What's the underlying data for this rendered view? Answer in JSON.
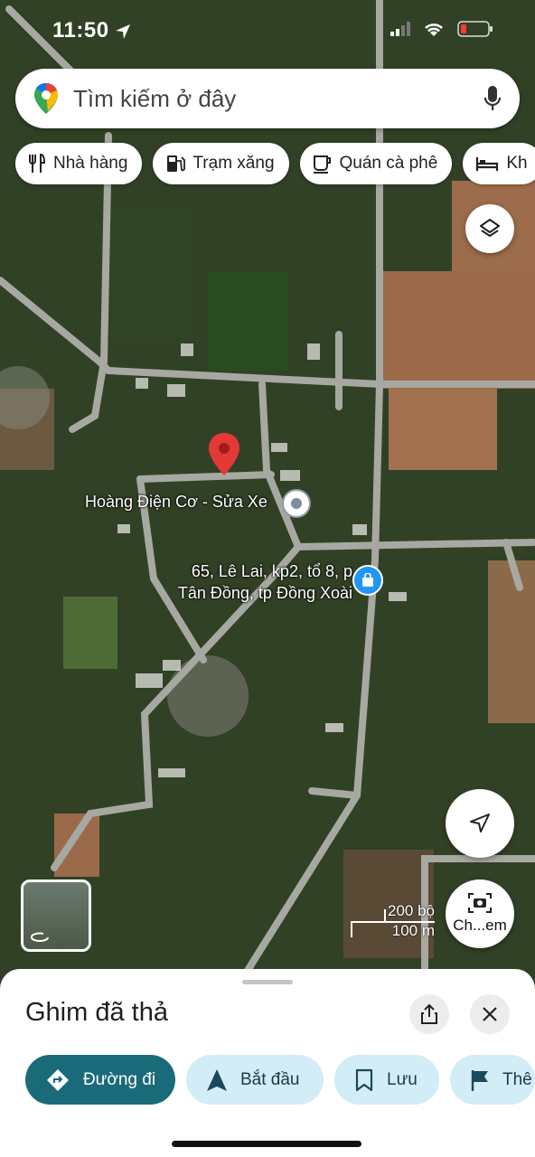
{
  "status_bar": {
    "time": "11:50"
  },
  "search": {
    "placeholder": "Tìm kiếm ở đây"
  },
  "chips": [
    {
      "label": "Nhà hàng",
      "icon": "fork-knife-icon"
    },
    {
      "label": "Trạm xăng",
      "icon": "gas-station-icon"
    },
    {
      "label": "Quán cà phê",
      "icon": "coffee-cup-icon"
    },
    {
      "label": "Kh",
      "icon": "bed-icon"
    }
  ],
  "map": {
    "place_label": "Hoàng Điện Cơ - Sửa Xe",
    "address_line1": "65, Lê Lai, kp2, tổ 8, p",
    "address_line2": "Tân Đồng, tp Đồng Xoài",
    "scale_top": "200 bộ",
    "scale_bottom": "100 m",
    "street_view_label": "Ch...em"
  },
  "sheet": {
    "title": "Ghim đã thả",
    "actions": {
      "directions": "Đường đi",
      "start": "Bắt đầu",
      "save": "Lưu",
      "more": "Thê"
    }
  },
  "colors": {
    "accent": "#1a6b7a",
    "secondary_button": "#d3edf7",
    "pin": "#e53935"
  }
}
